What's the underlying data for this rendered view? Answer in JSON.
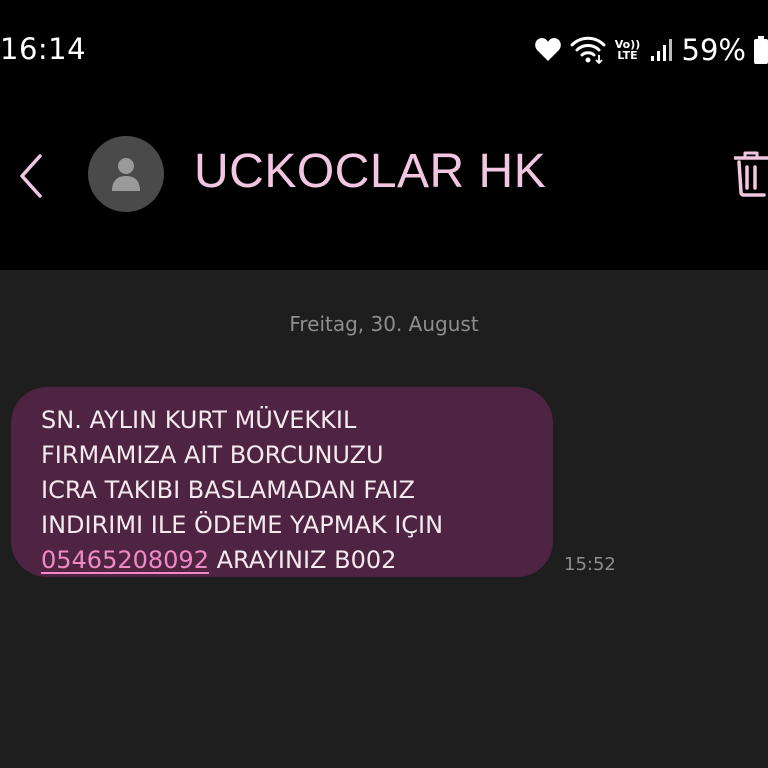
{
  "status_bar": {
    "time": "16:14",
    "lte_top": "Vo))",
    "lte_bottom": "LTE",
    "battery_percent": "59%",
    "icons": [
      "heart-icon",
      "wifi-icon",
      "volte-lte-icon",
      "signal-icon",
      "battery-icon"
    ]
  },
  "header": {
    "contact_name": "UCKOCLAR HK",
    "icons": [
      "back-arrow-icon",
      "avatar-person-icon",
      "trash-icon"
    ],
    "accent_color": "#f2c6e0"
  },
  "conversation": {
    "date_divider": "Freitag, 30. August",
    "message": {
      "lines": [
        "SN. AYLIN KURT MÜVEKKIL",
        "FIRMAMIZA AIT BORCUNUZU",
        "ICRA TAKIBI BASLAMADAN FAIZ",
        "INDIRIMI ILE ÖDEME YAPMAK IÇIN"
      ],
      "phone_number": "05465208092",
      "last_line_suffix": " ARAYINIZ B002",
      "time": "15:52",
      "bubble_color": "#4f2442",
      "link_color": "#f08ac6"
    }
  }
}
